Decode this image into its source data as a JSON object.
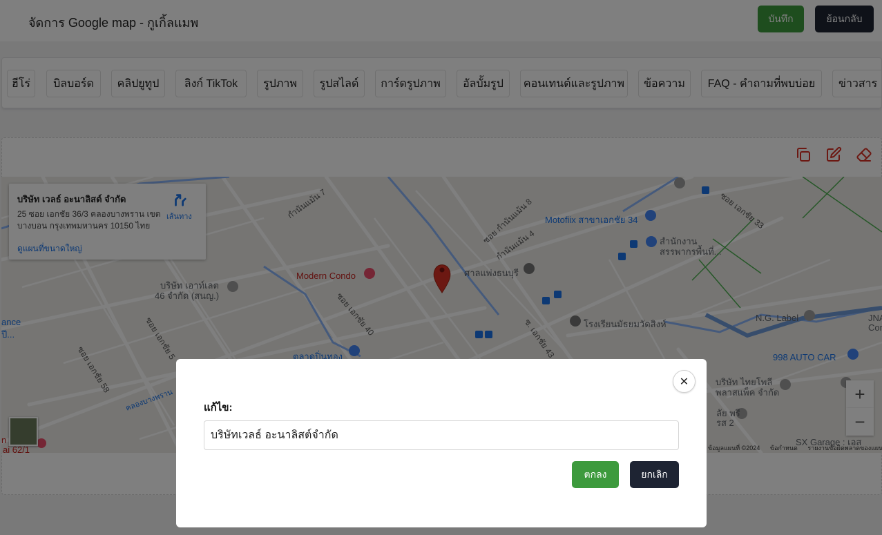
{
  "header": {
    "title": "จัดการ Google map - กูเกิ้ลแมพ",
    "save_label": "บันทึก",
    "back_label": "ย้อนกลับ"
  },
  "tabs": [
    {
      "label": "ฮีโร่"
    },
    {
      "label": "บิลบอร์ด"
    },
    {
      "label": "คลิปยูทูป"
    },
    {
      "label": "ลิงก์ TikTok"
    },
    {
      "label": "รูปภาพ"
    },
    {
      "label": "รูปสไลด์"
    },
    {
      "label": "การ์ดรูปภาพ"
    },
    {
      "label": "อัลบั้มรูป"
    },
    {
      "label": "คอนเทนต์และรูปภาพ"
    },
    {
      "label": "ข้อความ"
    },
    {
      "label": "FAQ - คำถามที่พบบ่อย"
    },
    {
      "label": "ข่าวสาร"
    }
  ],
  "section_tools": {
    "icons": [
      "copy-icon",
      "edit-icon",
      "eraser-icon"
    ]
  },
  "map": {
    "info_card": {
      "name": "บริษัท เวลธ์ อะนาลิสต์ จำกัด",
      "address": "25 ซอย เอกชัย 36/3 คลองบางพราน เขต บางบอน กรุงเทพมหานคร 10150 ไทย",
      "directions_label": "เส้นทาง",
      "larger_map_label": "ดูแผนที่ขนาดใหญ่"
    },
    "labels": {
      "motofiix": "Motofiix สาขาเอกชัย 34",
      "tax_office_1": "สำนักงาน",
      "tax_office_2": "สรรพากรพื้นที่...",
      "modern_condo": "Modern Condo",
      "shrine": "ศาลแพ่งธนบุรี",
      "company_left_1": "บริษัท เอาท์เลต",
      "company_left_2": "46 จำกัด (สนญ.)",
      "school": "โรงเรียนมัธยมวัดสิงห์",
      "ng_label": "N.G. Label",
      "auto_car": "998 AUTO CAR",
      "market": "ตลาดปิ่นทอง",
      "thai_pole_1": "บริษัท ไทยโพลี",
      "thai_pole_2": "พลาสแพ็ค จำกัด",
      "sx_garage": "SX Garage : เอส",
      "jna": "JNA",
      "com": "Com",
      "road_7": "กำนันแม้น 7",
      "road_8": "ซอย กำนันแม้น 8",
      "road_4": "กำนันแม้น 4",
      "road_33": "ซอย เอกชัย 33",
      "road_40": "ซอย เอกชัย 40",
      "road_43": "ซ. เอกชัย 43",
      "road_58": "ซอย เอกชัย 58",
      "road_5x": "ซอย เอกชัย 5",
      "canal": "คลองบางพราน",
      "left_ance": "ance",
      "left_ii": "ปี...",
      "bottom_ai": "ai 62/1",
      "bottom_n": "n",
      "r_sub1": "ลัย พรี",
      "r_sub2": "รส 2"
    },
    "zoom_in": "+",
    "zoom_out": "−",
    "attribution": {
      "data": "ข้อมูลแผนที่ ©2024",
      "terms": "ข้อกำหนด",
      "report": "รายงานข้อผิดพลาดของแผนที่"
    }
  },
  "modal": {
    "label": "แก้ไข:",
    "input_value": "บริษัทเวลธ์ อะนาลิสต์จำกัด",
    "ok_label": "ตกลง",
    "cancel_label": "ยกเลิก",
    "close_glyph": "✕"
  },
  "colors": {
    "green": "#3d9a3d",
    "dark": "#1e2433",
    "danger": "#d93025"
  }
}
